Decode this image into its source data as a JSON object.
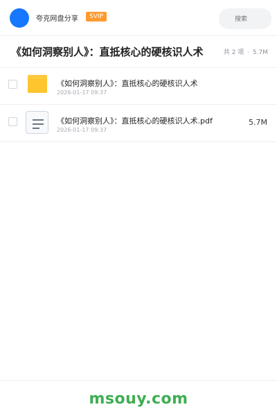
{
  "header": {
    "brand": "夸克网盘分享",
    "badge": "SVIP",
    "search_placeholder": "搜索"
  },
  "share": {
    "title": "《如何洞察别人》：直抵核心的硬核识人术",
    "count": "共 2 项",
    "separator": "·",
    "total_size": "5.7M"
  },
  "files": [
    {
      "name": "《如何洞察别人》：直抵核心的硬核识人术",
      "date": "2026-01-17 09:37",
      "size": "",
      "icon": "folder-icon"
    },
    {
      "name": "《如何洞察别人》：直抵核心的硬核识人术.pdf",
      "date": "2026-01-17 09:37",
      "size": "5.7M",
      "icon": "document-icon"
    }
  ],
  "footer": {
    "watermark": "msouy.com"
  },
  "colors": {
    "accent": "#1677ff",
    "svip": "#ff9a2e",
    "folder": "#ffc52e",
    "watermark": "#3fad53"
  }
}
